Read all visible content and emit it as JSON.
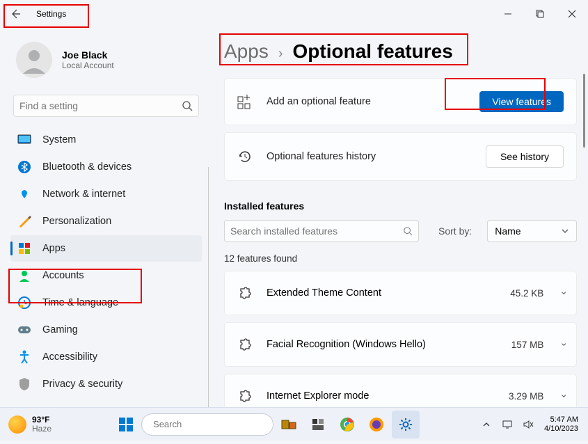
{
  "titlebar": {
    "title": "Settings"
  },
  "profile": {
    "name": "Joe Black",
    "subtitle": "Local Account"
  },
  "search": {
    "placeholder": "Find a setting"
  },
  "nav": {
    "items": [
      {
        "icon": "system",
        "label": "System"
      },
      {
        "icon": "bluetooth",
        "label": "Bluetooth & devices"
      },
      {
        "icon": "wifi",
        "label": "Network & internet"
      },
      {
        "icon": "brush",
        "label": "Personalization"
      },
      {
        "icon": "apps",
        "label": "Apps"
      },
      {
        "icon": "account",
        "label": "Accounts"
      },
      {
        "icon": "time",
        "label": "Time & language"
      },
      {
        "icon": "gaming",
        "label": "Gaming"
      },
      {
        "icon": "accessibility",
        "label": "Accessibility"
      },
      {
        "icon": "privacy",
        "label": "Privacy & security"
      }
    ],
    "active_index": 4
  },
  "breadcrumb": {
    "parent": "Apps",
    "current": "Optional features"
  },
  "cards": {
    "add": {
      "label": "Add an optional feature",
      "button": "View features"
    },
    "history": {
      "label": "Optional features history",
      "button": "See history"
    }
  },
  "installed": {
    "title": "Installed features",
    "search_placeholder": "Search installed features",
    "sort_label": "Sort by:",
    "sort_value": "Name",
    "count_label": "12 features found",
    "items": [
      {
        "name": "Extended Theme Content",
        "size": "45.2 KB"
      },
      {
        "name": "Facial Recognition (Windows Hello)",
        "size": "157 MB"
      },
      {
        "name": "Internet Explorer mode",
        "size": "3.29 MB"
      }
    ]
  },
  "taskbar": {
    "weather": {
      "temp": "93°F",
      "condition": "Haze"
    },
    "search_placeholder": "Search",
    "time": "5:47 AM",
    "date": "4/10/2023"
  }
}
